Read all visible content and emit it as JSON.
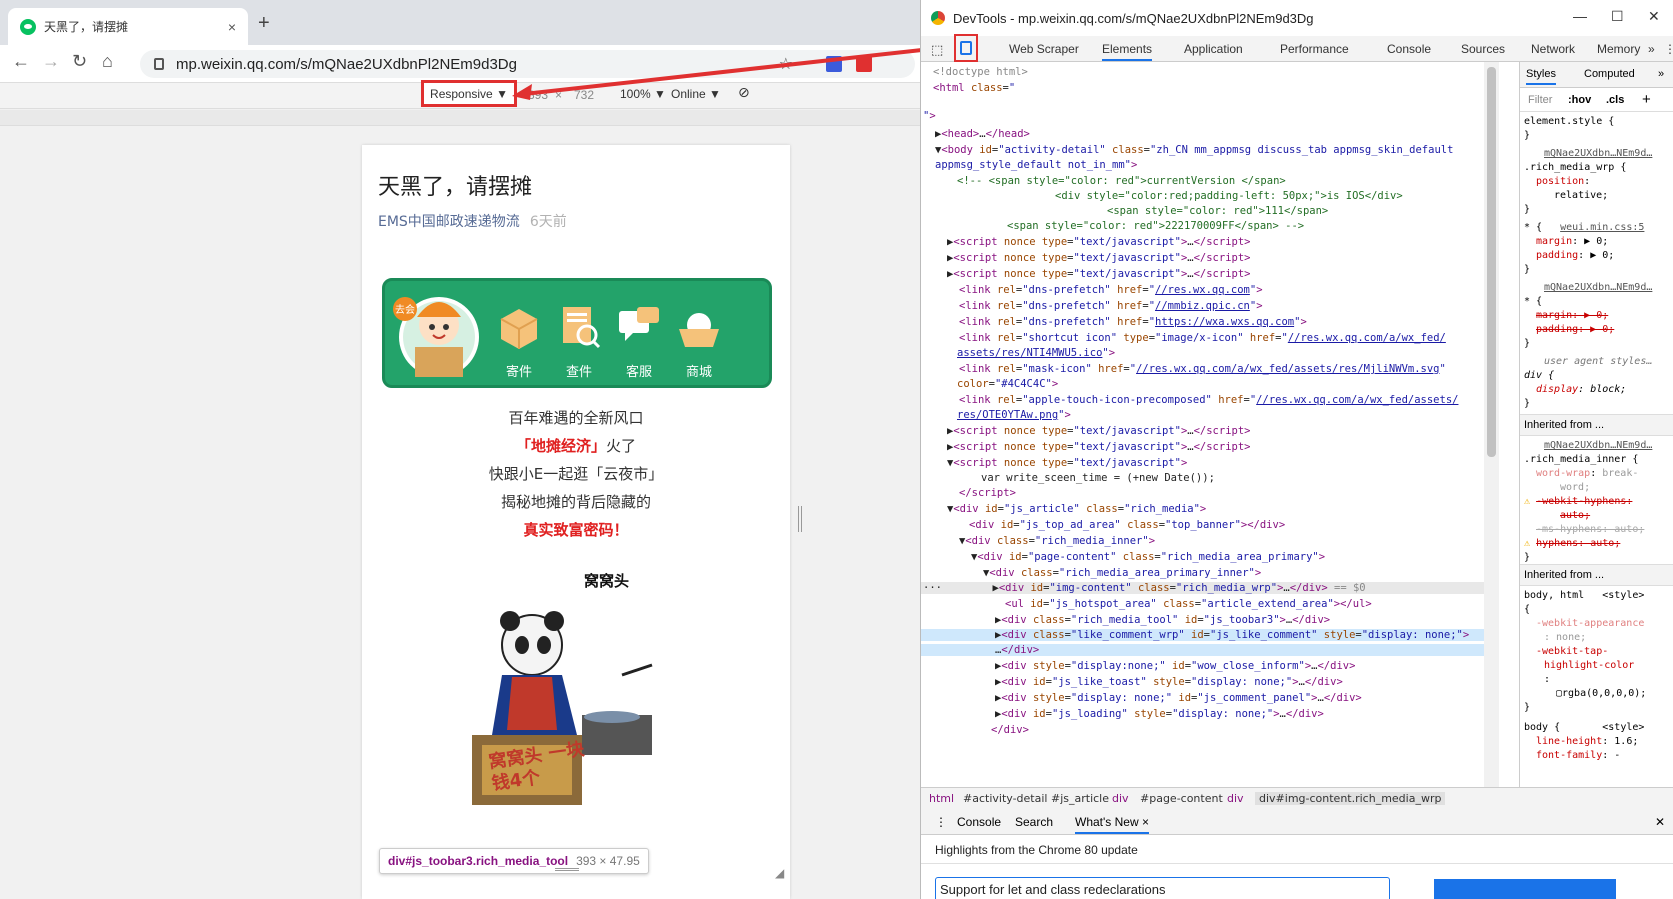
{
  "browser": {
    "tab_title": "天黑了，请摆摊",
    "tab_close": "×",
    "new_tab": "+",
    "url": "mp.weixin.qq.com/s/mQNae2UXdbnPl2NEm9d3Dg"
  },
  "device_toolbar": {
    "mode": "Responsive ▼",
    "width": "393",
    "times": "×",
    "height": "732",
    "zoom": "100% ▼",
    "network": "Online ▼"
  },
  "article": {
    "title": "天黑了，请摆摊",
    "source": "EMS中国邮政速递物流",
    "time": "6天前",
    "banner_items": [
      "寄件",
      "查件",
      "客服",
      "商城"
    ],
    "mascot_badge": "去会",
    "lines": [
      "百年难遇的全新风口",
      "「地摊经济」",
      "火了",
      "快跟小E一起逛「云夜市」",
      "揭秘地摊的背后隐藏的",
      "真实致富密码！"
    ],
    "meme_caption": "窝窝头",
    "meme_sign": "窝窝头 一块钱4个"
  },
  "tooltip": {
    "selector": "div#js_toobar3.rich_media_tool",
    "size": "393 × 47.95"
  },
  "devtools": {
    "title": "DevTools - mp.weixin.qq.com/s/mQNae2UXdbnPl2NEm9d3Dg",
    "tabs": [
      "Web Scraper",
      "Elements",
      "Application",
      "Performance",
      "Console",
      "Sources",
      "Network",
      "Memory",
      "»"
    ],
    "styles_tabs": [
      "Styles",
      "Computed",
      "»"
    ],
    "filter": "Filter",
    "hov": ":hov",
    "cls": ".cls",
    "plus": "+",
    "breadcrumb": [
      "html",
      "#activity-detail",
      "#js_article",
      "div",
      "#page-content",
      "div",
      "div#img-content.rich_media_wrp"
    ],
    "drawer_tabs": [
      "Console",
      "Search",
      "What's New ×"
    ],
    "drawer_heading": "Highlights from the Chrome 80 update",
    "drawer_item": "Support for let and class redeclarations",
    "inherited1": "Inherited from ...",
    "inherited2": "Inherited from ..."
  },
  "colors": {
    "accent_red": "#e03030",
    "wechat_green": "#07c160",
    "ems_green": "#23a36a",
    "tag": "#881280",
    "attr": "#994500",
    "val": "#1a1aa6"
  }
}
